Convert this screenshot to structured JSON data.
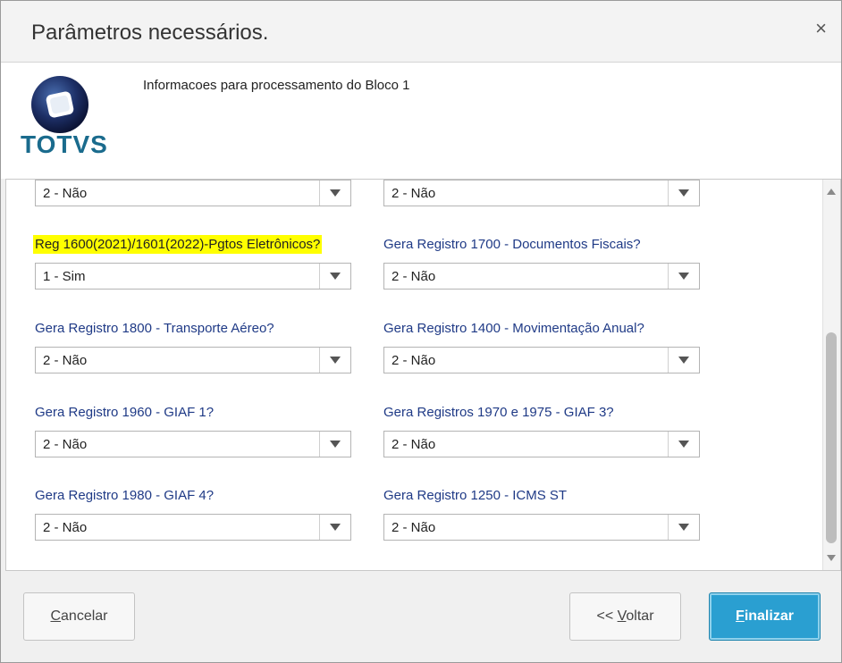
{
  "dialog": {
    "title": "Parâmetros necessários.",
    "close_symbol": "×"
  },
  "header": {
    "logo_text": "TOTVS",
    "subtitle": "Informacoes para processamento do Bloco 1"
  },
  "fields": [
    {
      "label": "",
      "value": "2 - Não"
    },
    {
      "label": "",
      "value": "2 - Não"
    },
    {
      "label": "Reg 1600(2021)/1601(2022)-Pgtos Eletrônicos?",
      "value": "1 - Sim",
      "highlighted": true
    },
    {
      "label": "Gera Registro 1700 - Documentos Fiscais?",
      "value": "2 - Não"
    },
    {
      "label": "Gera Registro 1800 - Transporte Aéreo?",
      "value": "2 - Não"
    },
    {
      "label": "Gera Registro 1400 - Movimentação Anual?",
      "value": "2 - Não"
    },
    {
      "label": "Gera Registro 1960 - GIAF 1?",
      "value": "2 - Não"
    },
    {
      "label": "Gera Registros 1970 e 1975 - GIAF 3?",
      "value": "2 - Não"
    },
    {
      "label": "Gera Registro 1980 - GIAF 4?",
      "value": "2 - Não"
    },
    {
      "label": "Gera Registro 1250 - ICMS ST",
      "value": "2 - Não"
    }
  ],
  "buttons": {
    "cancel": {
      "first": "C",
      "rest": "ancelar"
    },
    "back": {
      "prefix": "<< ",
      "first": "V",
      "rest": "oltar"
    },
    "finish": {
      "first": "F",
      "rest": "inalizar"
    }
  },
  "colors": {
    "label": "#1f3a86",
    "highlight": "#ffff00",
    "primary_button": "#2a9fd1",
    "logo_blue": "#1a6b8d"
  }
}
